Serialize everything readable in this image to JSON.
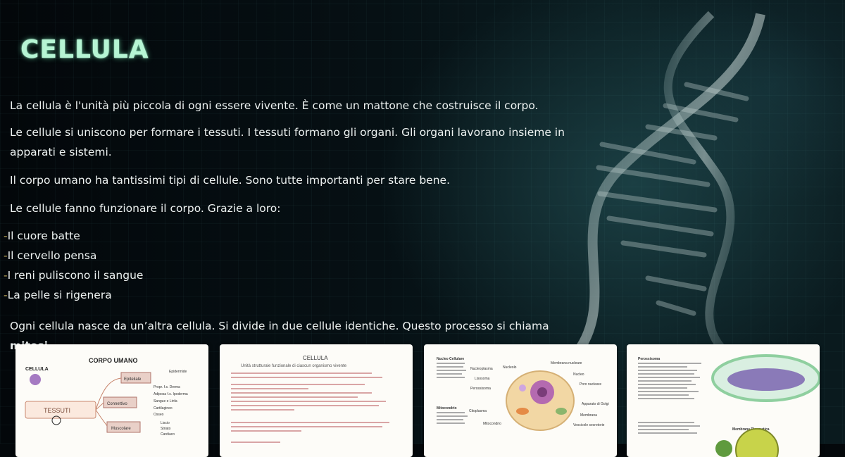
{
  "page": {
    "title": "CELLULA",
    "paragraphs": [
      "La cellula è l'unità più piccola di ogni essere vivente. È come un mattone che costruisce il corpo.",
      "Le cellule si uniscono per formare i tessuti. I tessuti formano gli organi. Gli organi lavorano insieme in apparati e sistemi.",
      "Il corpo umano ha tantissimi tipi di cellule. Sono tutte importanti per stare bene.",
      "Le cellule fanno funzionare il corpo. Grazie a loro:"
    ],
    "bullets": [
      "Il cuore batte",
      "Il cervello pensa",
      "I reni puliscono il sangue",
      "La pelle si rigenera"
    ],
    "bullet_marker": "-",
    "last_paragraph_prefix": "Ogni cellula nasce da un’altra cellula. Si divide in due cellule identiche. Questo processo si chiama ",
    "last_paragraph_bold": "mitosi",
    "last_paragraph_suffix": "."
  },
  "cards": [
    {
      "title": "CORPO UMANO",
      "left_label": "CELLULA",
      "center_label": "TESSUTI",
      "branches": [
        "Epiteliale",
        "Connettivo",
        "Muscolare"
      ],
      "leaves": [
        "Epidermide",
        "Propr. f.s. Derma",
        "Adiposa f.s. Ipoderma",
        "Sangue e Linfa",
        "Cartilagineo",
        "Osseo",
        "Liscio",
        "Striato",
        "Cardiaco"
      ]
    },
    {
      "title": "CELLULA",
      "subtitle": "Unità strutturale funzionale di ciascun organismo vivente"
    },
    {
      "side_title_1": "Nucleo Cellulare",
      "side_title_2": "Mitocondrio",
      "labels": [
        "Nucleolo",
        "Membrana nucleare",
        "Nucleoplasma",
        "Nucleo",
        "Lisosoma",
        "Poro nucleare",
        "Perossisoma",
        "Apparato di Golgi",
        "Citoplasma",
        "Membrana",
        "Mitocondrio",
        "Vescicole secretorie"
      ]
    },
    {
      "side_title": "Perossisoma",
      "label_bottom": "Membrana Plasmatica"
    }
  ],
  "colors": {
    "title_glow": "#b6f5d4",
    "bullet_dash": "#b8a45a",
    "text": "#eef3f2"
  }
}
